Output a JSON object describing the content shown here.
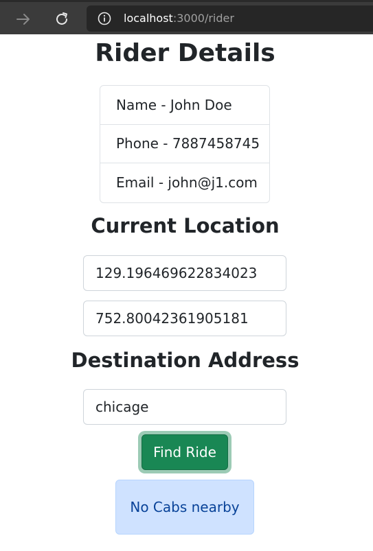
{
  "browser": {
    "url_host": "localhost",
    "url_rest": ":3000/rider"
  },
  "page": {
    "title": "Rider Details",
    "rider": [
      {
        "label": "Name - John Doe"
      },
      {
        "label": "Phone - 7887458745"
      },
      {
        "label": "Email - john@j1.com"
      }
    ],
    "current_location": {
      "heading": "Current Location",
      "latitude": "129.196469622834023",
      "longitude": "752.80042361905181"
    },
    "destination": {
      "heading": "Destination Address",
      "value": "chicage"
    },
    "find_ride_label": "Find Ride",
    "alert_text": "No Cabs nearby"
  },
  "colors": {
    "button": "#198754",
    "alert_bg": "#cfe2ff",
    "alert_text": "#084298",
    "browser_chrome": "#3b3b3b"
  },
  "icons": [
    "forward-arrow-icon",
    "reload-icon",
    "info-icon"
  ]
}
